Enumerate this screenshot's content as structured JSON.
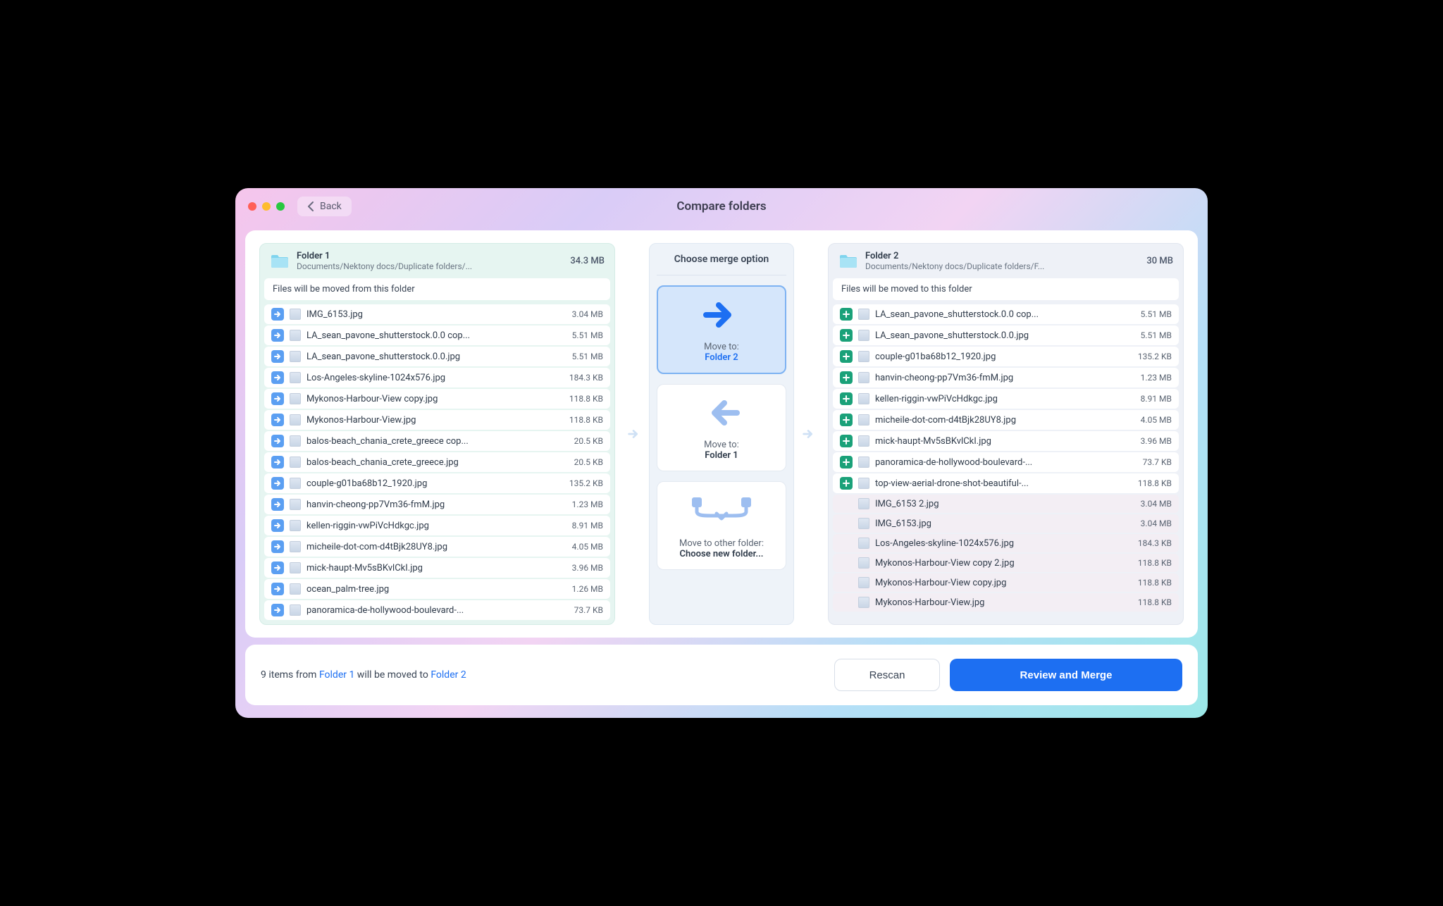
{
  "window": {
    "title": "Compare folders",
    "back_label": "Back"
  },
  "merge": {
    "heading": "Choose merge option",
    "opt1_label": "Move to:",
    "opt1_target": "Folder 2",
    "opt2_label": "Move to:",
    "opt2_target": "Folder 1",
    "opt3_label": "Move to other folder:",
    "opt3_target": "Choose new folder..."
  },
  "folderA": {
    "name": "Folder 1",
    "path": "Documents/Nektony docs/Duplicate folders/...",
    "size": "34.3 MB",
    "hint": "Files will be moved from this folder",
    "files": [
      {
        "icon": "move",
        "name": "IMG_6153.jpg",
        "size": "3.04 MB"
      },
      {
        "icon": "move",
        "name": "LA_sean_pavone_shutterstock.0.0 cop...",
        "size": "5.51 MB"
      },
      {
        "icon": "move",
        "name": "LA_sean_pavone_shutterstock.0.0.jpg",
        "size": "5.51 MB"
      },
      {
        "icon": "move",
        "name": "Los-Angeles-skyline-1024x576.jpg",
        "size": "184.3 KB"
      },
      {
        "icon": "move",
        "name": "Mykonos-Harbour-View copy.jpg",
        "size": "118.8 KB"
      },
      {
        "icon": "move",
        "name": "Mykonos-Harbour-View.jpg",
        "size": "118.8 KB"
      },
      {
        "icon": "move",
        "name": "balos-beach_chania_crete_greece cop...",
        "size": "20.5 KB"
      },
      {
        "icon": "move",
        "name": "balos-beach_chania_crete_greece.jpg",
        "size": "20.5 KB"
      },
      {
        "icon": "move",
        "name": "couple-g01ba68b12_1920.jpg",
        "size": "135.2 KB"
      },
      {
        "icon": "move",
        "name": "hanvin-cheong-pp7Vm36-fmM.jpg",
        "size": "1.23 MB"
      },
      {
        "icon": "move",
        "name": "kellen-riggin-vwPiVcHdkgc.jpg",
        "size": "8.91 MB"
      },
      {
        "icon": "move",
        "name": "micheile-dot-com-d4tBjk28UY8.jpg",
        "size": "4.05 MB"
      },
      {
        "icon": "move",
        "name": "mick-haupt-Mv5sBKvlCkI.jpg",
        "size": "3.96 MB"
      },
      {
        "icon": "move",
        "name": "ocean_palm-tree.jpg",
        "size": "1.26 MB"
      },
      {
        "icon": "move",
        "name": "panoramica-de-hollywood-boulevard-...",
        "size": "73.7 KB"
      }
    ]
  },
  "folderB": {
    "name": "Folder 2",
    "path": "Documents/Nektony docs/Duplicate folders/F...",
    "size": "30 MB",
    "hint": "Files will be moved to this folder",
    "files": [
      {
        "icon": "add",
        "name": "LA_sean_pavone_shutterstock.0.0 cop...",
        "size": "5.51 MB"
      },
      {
        "icon": "add",
        "name": "LA_sean_pavone_shutterstock.0.0.jpg",
        "size": "5.51 MB"
      },
      {
        "icon": "add",
        "name": "couple-g01ba68b12_1920.jpg",
        "size": "135.2 KB"
      },
      {
        "icon": "add",
        "name": "hanvin-cheong-pp7Vm36-fmM.jpg",
        "size": "1.23 MB"
      },
      {
        "icon": "add",
        "name": "kellen-riggin-vwPiVcHdkgc.jpg",
        "size": "8.91 MB"
      },
      {
        "icon": "add",
        "name": "micheile-dot-com-d4tBjk28UY8.jpg",
        "size": "4.05 MB"
      },
      {
        "icon": "add",
        "name": "mick-haupt-Mv5sBKvlCkI.jpg",
        "size": "3.96 MB"
      },
      {
        "icon": "add",
        "name": "panoramica-de-hollywood-boulevard-...",
        "size": "73.7 KB"
      },
      {
        "icon": "add",
        "name": "top-view-aerial-drone-shot-beautiful-...",
        "size": "118.8 KB"
      },
      {
        "icon": "none",
        "dim": true,
        "name": "IMG_6153 2.jpg",
        "size": "3.04 MB"
      },
      {
        "icon": "none",
        "dim": true,
        "name": "IMG_6153.jpg",
        "size": "3.04 MB"
      },
      {
        "icon": "none",
        "dim": true,
        "name": "Los-Angeles-skyline-1024x576.jpg",
        "size": "184.3 KB"
      },
      {
        "icon": "none",
        "dim": true,
        "name": "Mykonos-Harbour-View copy 2.jpg",
        "size": "118.8 KB"
      },
      {
        "icon": "none",
        "dim": true,
        "name": "Mykonos-Harbour-View copy.jpg",
        "size": "118.8 KB"
      },
      {
        "icon": "none",
        "dim": true,
        "name": "Mykonos-Harbour-View.jpg",
        "size": "118.8 KB"
      }
    ]
  },
  "footer": {
    "summary_prefix": "9 items from ",
    "summary_src": "Folder 1",
    "summary_mid": " will be moved to ",
    "summary_dst": "Folder 2",
    "rescan_label": "Rescan",
    "merge_label": "Review and Merge"
  }
}
